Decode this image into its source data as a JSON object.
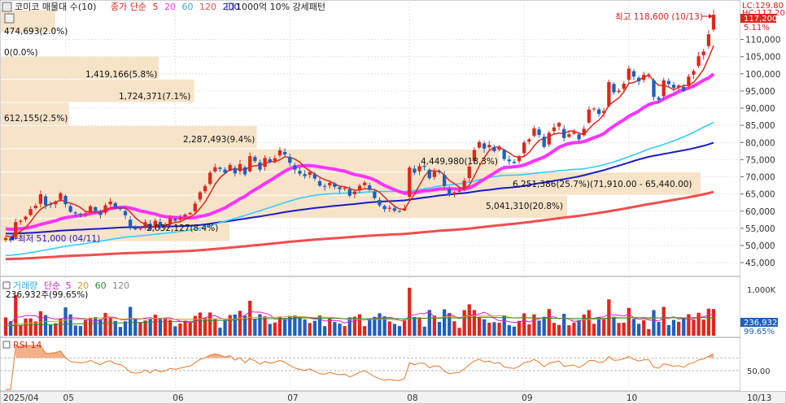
{
  "header": {
    "title": "코미코 매물대 수(10)",
    "ma_label": "종가 단순",
    "ma_periods": [
      "5",
      "20",
      "60",
      "120",
      "200"
    ],
    "ma_colors": [
      "#e0261c",
      "#ff33ff",
      "#33ccff",
      "#f24d4d",
      "#1a1acc"
    ],
    "pattern_label": "1000억 10% 강세패턴",
    "lc_label": "LC:129.80",
    "hc_label": "HC:117.20"
  },
  "annotations": {
    "high_label": "최고 118,600 (10/13)",
    "low_label": "최저 51,000 (04/11)",
    "current_price": "117,200",
    "current_pct": "5.11%"
  },
  "volume_profile": [
    {
      "label": "474,693(2.0%)"
    },
    {
      "label": "0(0.0%)"
    },
    {
      "label": "1,419,166(5.8%)"
    },
    {
      "label": "1,724,371(7.1%)"
    },
    {
      "label": "612,155(2.5%)"
    },
    {
      "label": "2,287,493(9.4%)"
    },
    {
      "label": "4,449,980(18.3%)"
    },
    {
      "label": "6,251,386(25.7%)(71,910.00 - 65,440.00)"
    },
    {
      "label": "5,041,310(20.8%)"
    },
    {
      "label": "2,032,127(8.4%)"
    }
  ],
  "volume_header": {
    "title": "거래량",
    "ma_label": "단순",
    "ma_periods": [
      "5",
      "20",
      "60",
      "120"
    ],
    "value_label": "236,932주(99.65%)",
    "current": "236,932",
    "current_pct": "99.65%",
    "axis_label": "1,000K"
  },
  "rsi_header": {
    "title": "RSI 14",
    "axis_label": "50.00"
  },
  "chart_data": {
    "type": "candlestick",
    "title": "코미코 매물대 수(10)",
    "y_ticks": [
      "110,000",
      "105,000",
      "100,000",
      "95,000",
      "90,000",
      "85,000",
      "80,000",
      "75,000",
      "70,000",
      "65,000",
      "60,000",
      "55,000",
      "50,000",
      "45,000"
    ],
    "ylim": [
      41000,
      121500
    ],
    "x_ticks": [
      "2025/04",
      "05",
      "06",
      "07",
      "08",
      "09",
      "10",
      "10/13"
    ],
    "x_tick_index": [
      0,
      12,
      34,
      57,
      81,
      104,
      125,
      145
    ],
    "grid": true,
    "closes": [
      52200,
      51500,
      56800,
      57200,
      58400,
      60600,
      61600,
      64900,
      61700,
      61800,
      62800,
      65200,
      62000,
      59800,
      59300,
      58900,
      59300,
      61400,
      60000,
      58900,
      61700,
      62800,
      61000,
      60600,
      58800,
      55400,
      54700,
      55000,
      56800,
      54600,
      57200,
      55300,
      56000,
      57900,
      57200,
      58100,
      59000,
      59500,
      62200,
      65500,
      67300,
      71200,
      72800,
      72300,
      71200,
      73400,
      71000,
      73700,
      70700,
      76000,
      74600,
      72100,
      75500,
      74200,
      75400,
      77700,
      76500,
      74100,
      72100,
      70900,
      70200,
      71400,
      69500,
      67400,
      67100,
      68300,
      67100,
      66400,
      66800,
      64500,
      65700,
      67400,
      68300,
      66200,
      63800,
      61700,
      60600,
      61000,
      60100,
      59900,
      60800,
      72700,
      71200,
      73100,
      72900,
      69600,
      71500,
      71300,
      67300,
      64700,
      65500,
      65900,
      68900,
      73000,
      77800,
      80100,
      78200,
      79300,
      77500,
      78600,
      75200,
      74500,
      74000,
      76000,
      80000,
      80900,
      84100,
      82200,
      78700,
      82800,
      84400,
      85700,
      81300,
      82400,
      83000,
      80900,
      84000,
      89600,
      89900,
      88300,
      89200,
      97600,
      94600,
      95100,
      97100,
      101500,
      99200,
      97800,
      99700,
      99800,
      93300,
      92500,
      98100,
      97000,
      95900,
      96600,
      95000,
      99200,
      100800,
      105100,
      106500,
      111500,
      117200
    ],
    "volume_profile_pct": [
      2.0,
      0.0,
      5.8,
      7.1,
      2.5,
      9.4,
      18.3,
      25.7,
      20.8,
      8.4
    ],
    "volume_profile_volume": [
      474693,
      0,
      1419166,
      1724371,
      612155,
      2287493,
      4449980,
      6251386,
      5041310,
      2032127
    ],
    "poc_range": [
      65440,
      71910
    ]
  }
}
